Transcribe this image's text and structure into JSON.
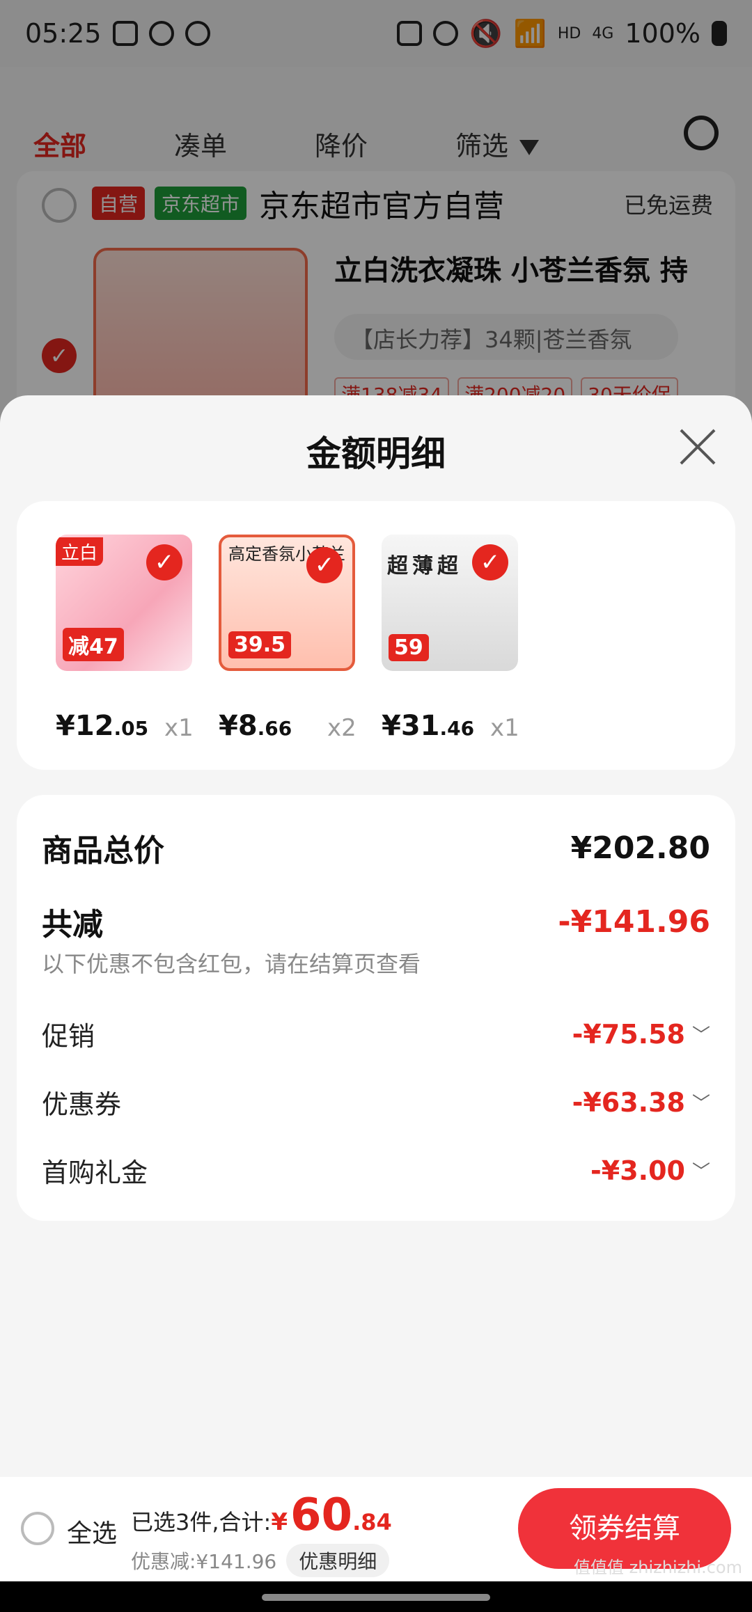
{
  "status_bar": {
    "time": "05:25",
    "battery": "100%",
    "network": "4G",
    "hd": "HD"
  },
  "tabs": [
    {
      "label": "全部",
      "active": true
    },
    {
      "label": "凑单"
    },
    {
      "label": "降价"
    },
    {
      "label": "筛选"
    }
  ],
  "shop": {
    "badge_self": "自营",
    "badge_market": "京东超市",
    "name": "京东超市官方自营",
    "shipping": "已免运费",
    "product_title": "立白洗衣凝珠 小苍兰香氛 持",
    "product_spec": "【店长力荐】34颗|苍兰香氛",
    "product_tags": [
      "满138减34",
      "满200减20",
      "30天价保"
    ]
  },
  "sheet": {
    "title": "金额明细",
    "items": [
      {
        "price_int": "¥12",
        "price_dec": ".05",
        "qty": "x1",
        "label": "立白",
        "promo": "减47"
      },
      {
        "price_int": "¥8",
        "price_dec": ".66",
        "qty": "x2",
        "label": "高定香氛小苍兰",
        "promo": "39.5"
      },
      {
        "price_int": "¥31",
        "price_dec": ".46",
        "qty": "x1",
        "label": "超薄超",
        "promo": "59"
      }
    ],
    "total_label": "商品总价",
    "total_value": "¥202.80",
    "reduce_label": "共减",
    "reduce_value": "-¥141.96",
    "reduce_note": "以下优惠不包含红包，请在结算页查看",
    "breakdown": [
      {
        "label": "促销",
        "value": "-¥75.58"
      },
      {
        "label": "优惠券",
        "value": "-¥63.38"
      },
      {
        "label": "首购礼金",
        "value": "-¥3.00"
      }
    ]
  },
  "bottom_bar": {
    "select_all": "全选",
    "selected_text": "已选3件,合计:",
    "currency": "¥",
    "amount_int": "60",
    "amount_dec": ".84",
    "discount_text": "优惠减:¥141.96",
    "detail_button": "优惠明细",
    "checkout_button": "领券结算"
  },
  "colors": {
    "accent": "#e4261f",
    "checkout": "#f0323a",
    "market_green": "#1e9e3a"
  },
  "watermark": "值值值 zhizhizhi.com"
}
